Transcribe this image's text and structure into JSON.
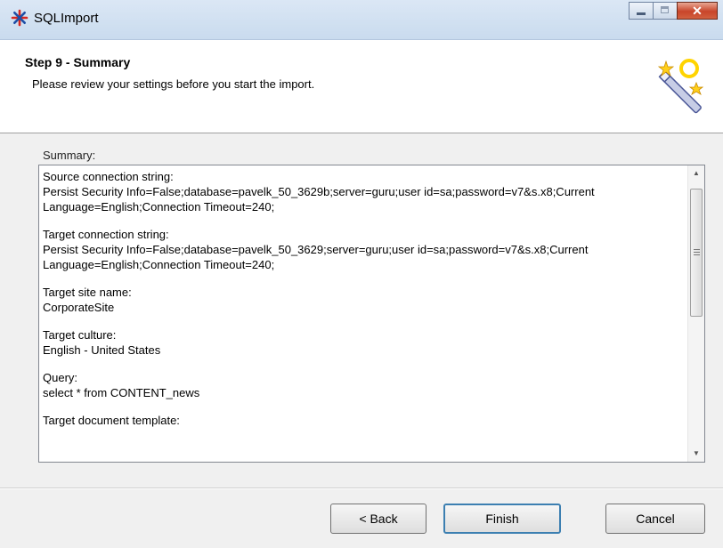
{
  "window": {
    "title": "SQLImport"
  },
  "header": {
    "step_title": "Step 9 - Summary",
    "description": "Please review your settings before you start the import."
  },
  "summary": {
    "label": "Summary:",
    "sections": [
      {
        "heading": "Source connection string:",
        "lines": [
          "Persist Security Info=False;database=pavelk_50_3629b;server=guru;user id=sa;password=v7&s.x8;Current",
          "Language=English;Connection Timeout=240;"
        ]
      },
      {
        "heading": "Target connection string:",
        "lines": [
          "Persist Security Info=False;database=pavelk_50_3629;server=guru;user id=sa;password=v7&s.x8;Current",
          "Language=English;Connection Timeout=240;"
        ]
      },
      {
        "heading": "Target site name:",
        "lines": [
          "CorporateSite"
        ]
      },
      {
        "heading": "Target culture:",
        "lines": [
          "English - United States"
        ]
      },
      {
        "heading": "Query:",
        "lines": [
          "select * from CONTENT_news"
        ]
      },
      {
        "heading": "Target document template:",
        "lines": []
      }
    ]
  },
  "buttons": {
    "back": "< Back",
    "finish": "Finish",
    "cancel": "Cancel"
  },
  "icons": {
    "app": "asterisk-app-icon",
    "header": "magic-wand-icon"
  },
  "colors": {
    "titlebar": "#c9dbee",
    "close_button": "#c8452a",
    "default_button_border": "#3c7fb1"
  }
}
